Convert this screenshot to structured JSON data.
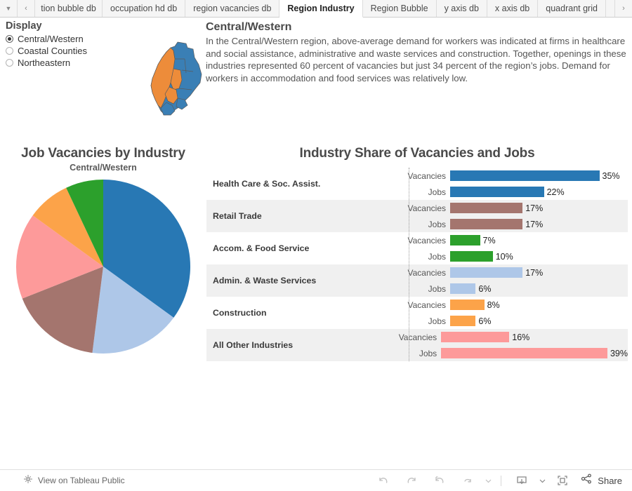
{
  "tabs": {
    "left_caret_icon": "caret-down-icon",
    "prev_icon": "chevron-left-icon",
    "next_icon": "chevron-right-icon",
    "items": [
      {
        "label": "tion bubble db",
        "active": false,
        "clipped": true
      },
      {
        "label": "occupation hd db",
        "active": false,
        "clipped": false
      },
      {
        "label": "region vacancies db",
        "active": false,
        "clipped": false
      },
      {
        "label": "Region Industry",
        "active": true,
        "clipped": false
      },
      {
        "label": "Region Bubble",
        "active": false,
        "clipped": false
      },
      {
        "label": "y axis db",
        "active": false,
        "clipped": false
      },
      {
        "label": "x axis db",
        "active": false,
        "clipped": false
      },
      {
        "label": "quadrant grid",
        "active": false,
        "clipped": false
      }
    ]
  },
  "display": {
    "title": "Display",
    "options": [
      {
        "label": "Central/Western",
        "selected": true
      },
      {
        "label": "Coastal Counties",
        "selected": false
      },
      {
        "label": "Northeastern",
        "selected": false
      }
    ]
  },
  "map": {
    "name": "maine-region-map",
    "highlight_color": "#ed8c3a",
    "base_color": "#3a7fb5"
  },
  "narrative": {
    "title": "Central/Western",
    "body": "In the Central/Western region, above-average demand for workers was indicated at firms in healthcare and social assistance, administrative and waste services and construction. Together, openings in these industries represented 60 percent of vacancies but just 34 percent of the region’s jobs. Demand for workers in accommodation and food services was relatively low."
  },
  "toolbar": {
    "view_label": "View on Tableau Public",
    "tableau_icon": "tableau-logo-icon",
    "undo_icon": "undo-icon",
    "redo_icon": "redo-icon",
    "revert_icon": "revert-icon",
    "refresh_icon": "refresh-icon",
    "refresh_caret_icon": "caret-down-icon",
    "download_icon": "download-icon",
    "download_caret_icon": "caret-down-icon",
    "fullscreen_icon": "fullscreen-icon",
    "share_icon": "share-icon",
    "share_label": "Share"
  },
  "chart_data": [
    {
      "type": "pie",
      "name": "job-vacancies-pie",
      "title": "Job Vacancies by Industry",
      "subtitle": "Central/Western",
      "start_angle": 0,
      "direction": "clockwise",
      "labels": [
        "Health Care & Soc. Assist.",
        "Admin. & Waste Services",
        "Retail Trade",
        "All Other Industries",
        "Construction",
        "Accom. & Food Service"
      ],
      "values": [
        35,
        17,
        17,
        16,
        8,
        7
      ],
      "colors": [
        "#2878b4",
        "#aec7e8",
        "#a4756e",
        "#fd9a9a",
        "#fca349",
        "#2ca02c"
      ]
    },
    {
      "type": "bar",
      "name": "industry-share-bars",
      "title": "Industry Share of Vacancies and Jobs",
      "orientation": "horizontal",
      "xlim": [
        0,
        42
      ],
      "grid": false,
      "measures": [
        "Vacancies",
        "Jobs"
      ],
      "categories": [
        "Health Care & Soc. Assist.",
        "Retail Trade",
        "Accom. & Food Service",
        "Admin. & Waste Services",
        "Construction",
        "All Other Industries"
      ],
      "series": [
        {
          "name": "Vacancies",
          "values": [
            35,
            17,
            7,
            17,
            8,
            16
          ]
        },
        {
          "name": "Jobs",
          "values": [
            22,
            17,
            10,
            6,
            6,
            39
          ]
        }
      ],
      "value_labels": [
        {
          "Vacancies": "35%",
          "Jobs": "22%"
        },
        {
          "Vacancies": "17%",
          "Jobs": "17%"
        },
        {
          "Vacancies": "7%",
          "Jobs": "10%"
        },
        {
          "Vacancies": "17%",
          "Jobs": "6%"
        },
        {
          "Vacancies": "8%",
          "Jobs": "6%"
        },
        {
          "Vacancies": "16%",
          "Jobs": "39%"
        }
      ],
      "colors": [
        "#2878b4",
        "#a4756e",
        "#2ca02c",
        "#aec7e8",
        "#fca349",
        "#fd9a9a"
      ],
      "banded_rows": [
        false,
        true,
        false,
        true,
        false,
        true
      ]
    }
  ]
}
